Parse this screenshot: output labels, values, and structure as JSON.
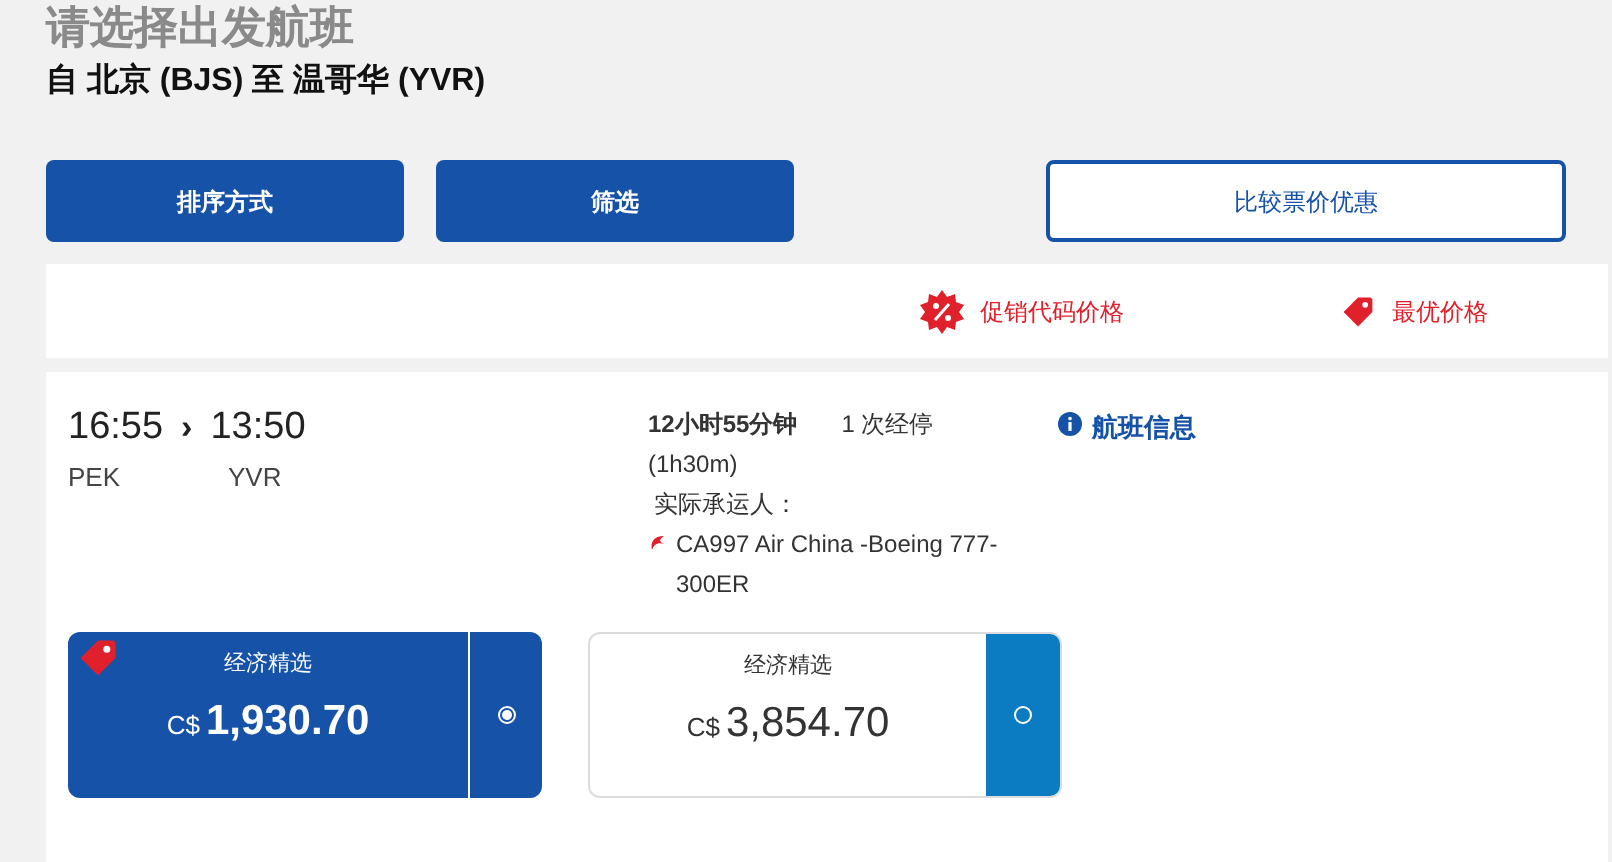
{
  "header": {
    "title": "请选择出发航班",
    "route": "自 北京 (BJS) 至 温哥华 (YVR)"
  },
  "actions": [
    {
      "label": "排序方式",
      "kind": "filled"
    },
    {
      "label": "筛选",
      "kind": "filled"
    },
    {
      "label": "比较票价优惠",
      "kind": "outlined"
    }
  ],
  "legend": [
    {
      "label": "促销代码价格",
      "kind": "promo"
    },
    {
      "label": "最优价格",
      "kind": "best"
    }
  ],
  "flight": {
    "depart_time": "16:55",
    "arrow": "›",
    "arrive_time": "13:50",
    "depart_code": "PEK",
    "arrive_code": "YVR",
    "duration": "12小时55分钟",
    "stops": "1 次经停",
    "layover": "(1h30m)",
    "carrier_label": "实际承运人：",
    "carrier": "CA997 Air China -Boeing 777-300ER",
    "info_link": "航班信息"
  },
  "fares": [
    {
      "cabin": "经济精选",
      "currency": "C$",
      "price": "1,930.70",
      "selected": true,
      "best": true
    },
    {
      "cabin": "经济精选",
      "currency": "C$",
      "price": "3,854.70",
      "selected": false,
      "best": false
    }
  ]
}
